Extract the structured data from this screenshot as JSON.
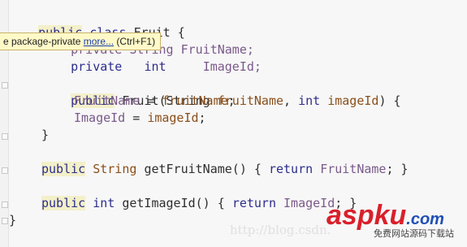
{
  "code": {
    "l1": {
      "kw1": "public",
      "kw2": "class",
      "name": "Fruit",
      "brace": "{"
    },
    "l2": {
      "frag": "private String FruitName;"
    },
    "l3": {
      "frag1": "private",
      "frag2": "int",
      "frag3": "ImageId;"
    },
    "l5": {
      "kw": "public",
      "name": "Fruit(",
      "t1": "String",
      "p1": "fruitName",
      "comma": ",",
      "t2": "int",
      "p2": "imageId",
      "end": ") {"
    },
    "l6": {
      "field": "FruitName",
      "eq": " = ",
      "param": "fruitName",
      "semi": ";"
    },
    "l7": {
      "field": "ImageId",
      "eq": " = ",
      "param": "imageId",
      "semi": ";"
    },
    "l8": {
      "brace": "}"
    },
    "l10": {
      "kw": "public",
      "type": "String",
      "method": "getFruitName()",
      "ob": "{",
      "ret": "return",
      "field": "FruitName",
      "cb": "; }"
    },
    "l12": {
      "kw": "public",
      "type": "int",
      "method": "getImageId()",
      "ob": "{",
      "ret": "return",
      "field": "ImageId",
      "cb": "; }"
    },
    "l13": {
      "brace": "}"
    }
  },
  "tooltip": {
    "text": "e package-private ",
    "link": "more...",
    "shortcut": " (Ctrl+F1)"
  },
  "watermark": {
    "url": "http://blog.csdn.",
    "logo": "aspku",
    "domain": ".com",
    "subtitle": "免费网站源码下载站"
  },
  "colors": {
    "keyword": "#2d2d8c",
    "field": "#7a5a8a",
    "param": "#8a4f1a",
    "tooltip_bg": "#fff9c8",
    "logo_red": "#d9202b",
    "logo_blue": "#1f4fb5"
  }
}
